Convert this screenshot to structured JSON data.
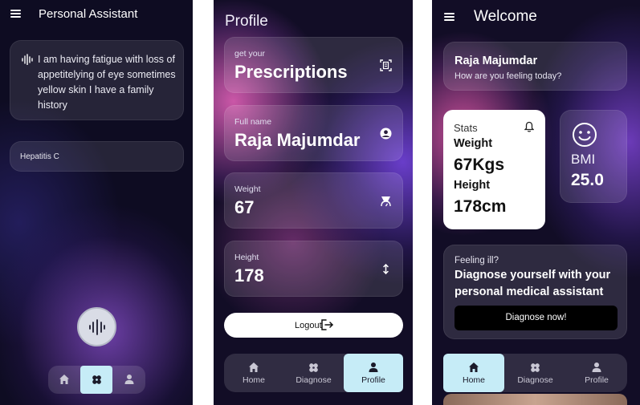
{
  "assistant": {
    "title": "Personal Assistant",
    "user_message": "I am having fatigue with loss of appetitelying of eye sometimes yellow skin I have a family history",
    "response": "Hepatitis C"
  },
  "profile": {
    "title": "Profile",
    "prescriptions": {
      "small": "get your",
      "big": "Prescriptions"
    },
    "fullname": {
      "small": "Full name",
      "big": "Raja Majumdar"
    },
    "weight": {
      "small": "Weight",
      "big": "67"
    },
    "height": {
      "small": "Height",
      "big": "178"
    },
    "logout_label": "Logout"
  },
  "welcome": {
    "title": "Welcome",
    "name": "Raja Majumdar",
    "question": "How are you feeling today?",
    "stats": {
      "title": "Stats",
      "weight_label": "Weight",
      "weight_value": "67Kgs",
      "height_label": "Height",
      "height_value": "178cm"
    },
    "bmi": {
      "label": "BMI",
      "value": "25.0"
    },
    "diagnose": {
      "prompt": "Feeling ill?",
      "headline": "Diagnose yourself with your personal medical assistant",
      "button": "Diagnose now!"
    }
  },
  "nav": {
    "home": "Home",
    "diagnose": "Diagnose",
    "profile": "Profile"
  },
  "colors": {
    "active_tab": "#c6ecf7",
    "card_white": "#ffffff",
    "button_black": "#000000"
  }
}
